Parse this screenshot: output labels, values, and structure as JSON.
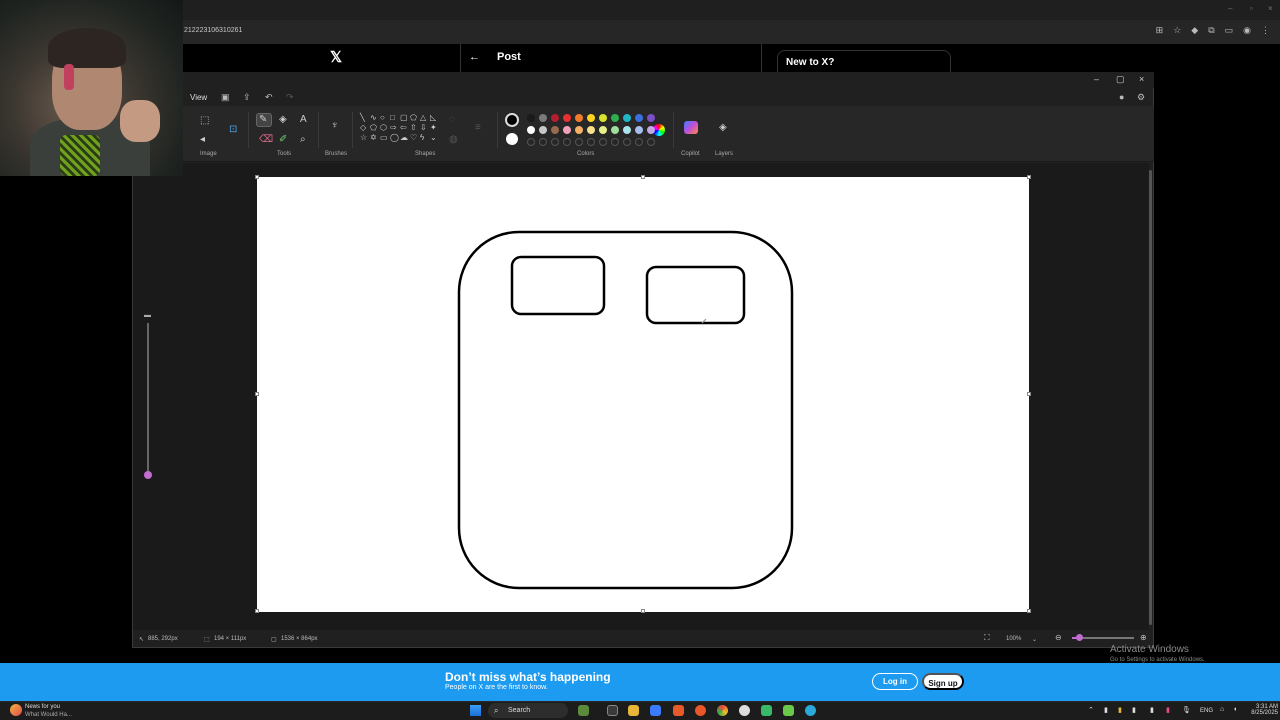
{
  "browser": {
    "url": "212223106310261"
  },
  "x_page": {
    "back_icon": "←",
    "post_title": "Post",
    "new_to_x": "New to X?"
  },
  "paint": {
    "menu_view": "View",
    "ribbon_labels": {
      "image": "Image",
      "tools": "Tools",
      "brushes": "Brushes",
      "shapes": "Shapes",
      "colors": "Colors",
      "copilot": "Copilot",
      "layers": "Layers"
    },
    "palette_row1": [
      "#1a1a1a",
      "#7a7a7a",
      "#b31f2e",
      "#e83030",
      "#f07c2a",
      "#ffd21f",
      "#d6e22b",
      "#2eae4e",
      "#1fb6c8",
      "#3a6fe0",
      "#7a4fc8"
    ],
    "palette_row2": [
      "#ffffff",
      "#c7c7c7",
      "#9a6a4e",
      "#f2a0b8",
      "#f5b063",
      "#f6e08b",
      "#e6f08a",
      "#9fdd9f",
      "#a8e4ec",
      "#a7bdf0",
      "#c3a8e6"
    ],
    "status": {
      "cursor_pos": "885, 292px",
      "selection_size": "194 × 111px",
      "canvas_size": "1536 × 864px",
      "zoom": "100%"
    }
  },
  "banner": {
    "title": "Don’t miss what’s happening",
    "subtitle": "People on X are the first to know.",
    "login": "Log in",
    "signup": "Sign up"
  },
  "watermark": {
    "title": "Activate Windows",
    "subtitle": "Go to Settings to activate Windows."
  },
  "taskbar": {
    "news_title": "News for you",
    "news_sub": "What Would Ha...",
    "search": "Search",
    "lang": "ENG",
    "time": "3:31 AM",
    "date": "8/25/2025"
  }
}
